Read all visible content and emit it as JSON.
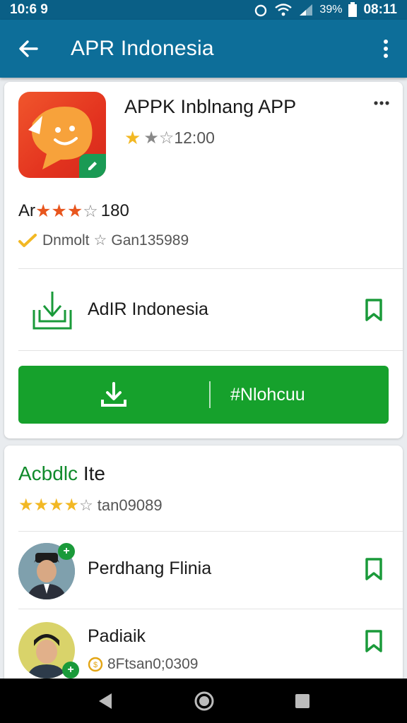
{
  "status": {
    "time": "10:6 9",
    "battery_pct": "39%",
    "clock_right": "08:11"
  },
  "appbar": {
    "title": "APR Indonesia"
  },
  "app": {
    "name": "APPK Inblnang APP",
    "rating_text": "12:00",
    "rating_label": "Ar",
    "rating_value": "180",
    "developer": "Dnmolt",
    "developer_meta": "Gan135989",
    "source_name": "AdIR Indonesia",
    "install_label": "#Nlohcuu"
  },
  "section": {
    "title_green": "Acbdlc",
    "title_rest": " Ite",
    "rating_text": "tan09089",
    "people": [
      {
        "name": "Perdhang Flinia",
        "sub": ""
      },
      {
        "name": "Padiaik",
        "sub": "8Ftsan0;0309"
      }
    ]
  },
  "colors": {
    "appbar": "#0d6e99",
    "status": "#0a5f86",
    "install": "#16a12c",
    "accent": "#0f8a2a",
    "star": "#f2b824"
  }
}
